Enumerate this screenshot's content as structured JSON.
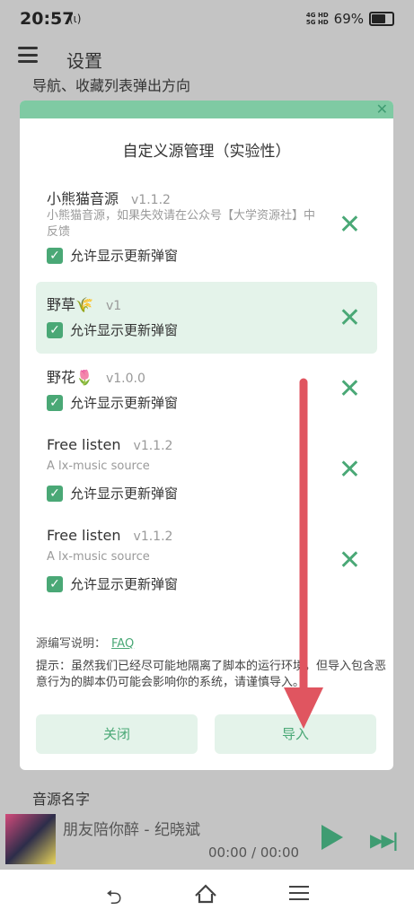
{
  "status": {
    "time": "20:57",
    "extra": "(ι)",
    "net1": "4G HD",
    "net2": "5G HD",
    "battery": "69%",
    "battery_level": 0.69
  },
  "header": {
    "title": "设置"
  },
  "behind": {
    "line1": "导航、收藏列表弹出方向",
    "line2": "音源名字"
  },
  "dialog": {
    "title": "自定义源管理（实验性）",
    "close_icon": "close-icon",
    "sources": [
      {
        "name": "小熊猫音源",
        "version": "v1.1.2",
        "desc": "小熊猫音源，如果失效请在公众号【大学资源社】中反馈",
        "check_label": "允许显示更新弹窗",
        "checked": true
      },
      {
        "name": "野草🌾",
        "version": "v1",
        "desc": "",
        "check_label": "允许显示更新弹窗",
        "checked": true
      },
      {
        "name": "野花🌷",
        "version": "v1.0.0",
        "desc": "",
        "check_label": "允许显示更新弹窗",
        "checked": true
      },
      {
        "name": "Free listen",
        "version": "v1.1.2",
        "desc": "A lx-music source",
        "check_label": "允许显示更新弹窗",
        "checked": true
      },
      {
        "name": "Free listen",
        "version": "v1.1.2",
        "desc": "A lx-music source",
        "check_label": "允许显示更新弹窗",
        "checked": true
      }
    ],
    "faq_label": "源编写说明：",
    "faq_link": "FAQ",
    "tip": "提示：虽然我们已经尽可能地隔离了脚本的运行环境，但导入包含恶意行为的脚本仍可能会影响你的系统，请谨慎导入。",
    "close_button": "关闭",
    "import_button": "导入"
  },
  "player": {
    "song": "朋友陪你醉 - 纪晓斌",
    "time": "00:00 / 00:00"
  },
  "colors": {
    "accent": "#4aa876",
    "arrow": "#e05560",
    "dialog_bar": "#7fcaa3"
  }
}
